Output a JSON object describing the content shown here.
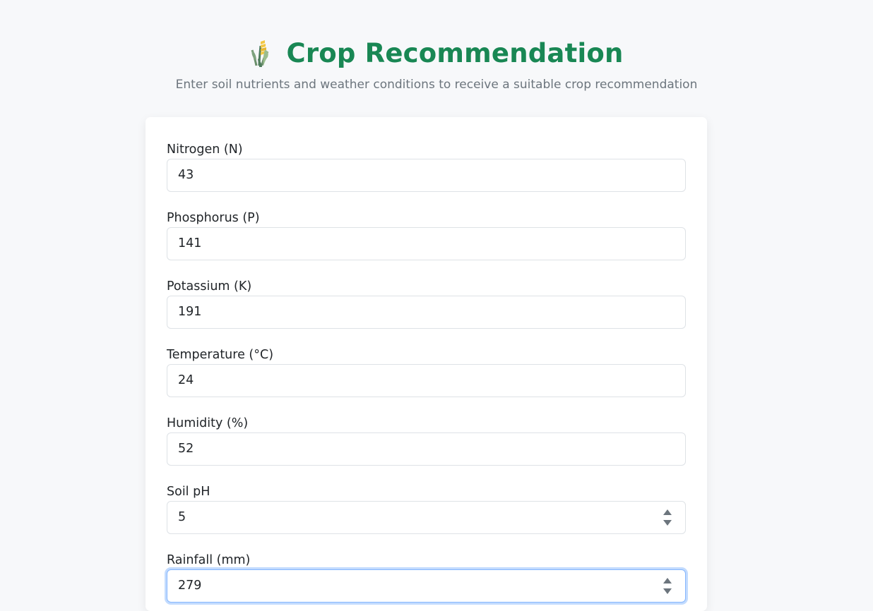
{
  "header": {
    "title": "Crop Recommendation",
    "subtitle": "Enter soil nutrients and weather conditions to receive a suitable crop recommendation",
    "icon": "sheaf-of-rice-icon"
  },
  "form": {
    "fields": [
      {
        "label": "Nitrogen (N)",
        "value": "43"
      },
      {
        "label": "Phosphorus (P)",
        "value": "141"
      },
      {
        "label": "Potassium (K)",
        "value": "191"
      },
      {
        "label": "Temperature (°C)",
        "value": "24"
      },
      {
        "label": "Humidity (%)",
        "value": "52"
      },
      {
        "label": "Soil pH",
        "value": "5"
      },
      {
        "label": "Rainfall (mm)",
        "value": "279"
      }
    ]
  },
  "colors": {
    "accent": "#198754",
    "background": "#f7f8fa",
    "focus": "#86b7fe"
  }
}
